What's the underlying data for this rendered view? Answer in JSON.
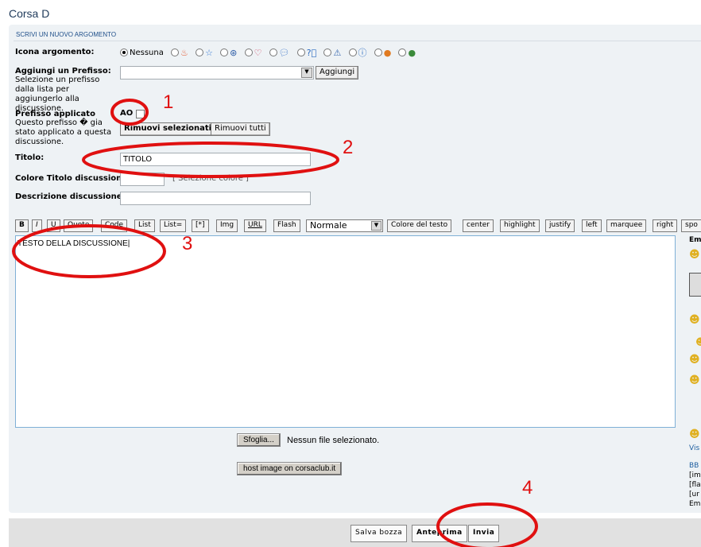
{
  "page_title": "Corsa D",
  "section_title": "SCRIVI UN NUOVO ARGOMENTO",
  "topic_icon": {
    "label": "Icona argomento:",
    "none_label": "Nessuna",
    "icons": [
      "fire-icon",
      "star-icon",
      "dots-icon",
      "heart-icon",
      "speech-bubble-icon",
      "question-icon",
      "warning-icon",
      "info-icon",
      "smiley-orange-icon",
      "smiley-green-icon"
    ],
    "selected": "Nessuna"
  },
  "prefix": {
    "label": "Aggiungi un Prefisso:",
    "description": "Selezione un prefisso dalla lista per aggiungerlo alla discussione.",
    "select_value": "",
    "add_button": "Aggiungi"
  },
  "applied_prefix": {
    "label": "Prefisso applicato",
    "description": "Questo prefisso � gia stato applicato a questa discussione.",
    "prefix_name": "AO",
    "remove_selected": "Rimuovi selezionati",
    "remove_all": "Rimuovi tutti"
  },
  "title_field": {
    "label": "Titolo:",
    "value": "TITOLO"
  },
  "title_color": {
    "label": "Colore Titolo discussione:",
    "value": "",
    "link": "[ Selezione colore ]"
  },
  "description_field": {
    "label": "Descrizione discussione:",
    "value": ""
  },
  "toolbar": [
    "B",
    "I",
    "U",
    "Quote",
    "Code",
    "List",
    "List=",
    "[*]",
    "Img",
    "URL",
    "Flash"
  ],
  "font_size_select": "Normale",
  "toolbar2": [
    "Colore del testo",
    "center",
    "highlight",
    "justify",
    "left",
    "marquee",
    "right",
    "spo"
  ],
  "message": "TESTO DELLA DISCUSSIONE",
  "sidebar": {
    "emoticons_heading": "Em",
    "view_all": "Vis",
    "bbcode": "BB",
    "lines": [
      "[im",
      "[fla",
      "[ur",
      "Em"
    ]
  },
  "upload": {
    "browse": "Sfoglia...",
    "no_file": "Nessun file selezionato.",
    "host_button": "host image on corsaclub.it"
  },
  "actions": {
    "save_draft": "Salva bozza",
    "preview": "Anteprima",
    "submit": "Invia"
  },
  "annotations": [
    "1",
    "2",
    "3",
    "4"
  ],
  "annotation_color": "#e01010"
}
